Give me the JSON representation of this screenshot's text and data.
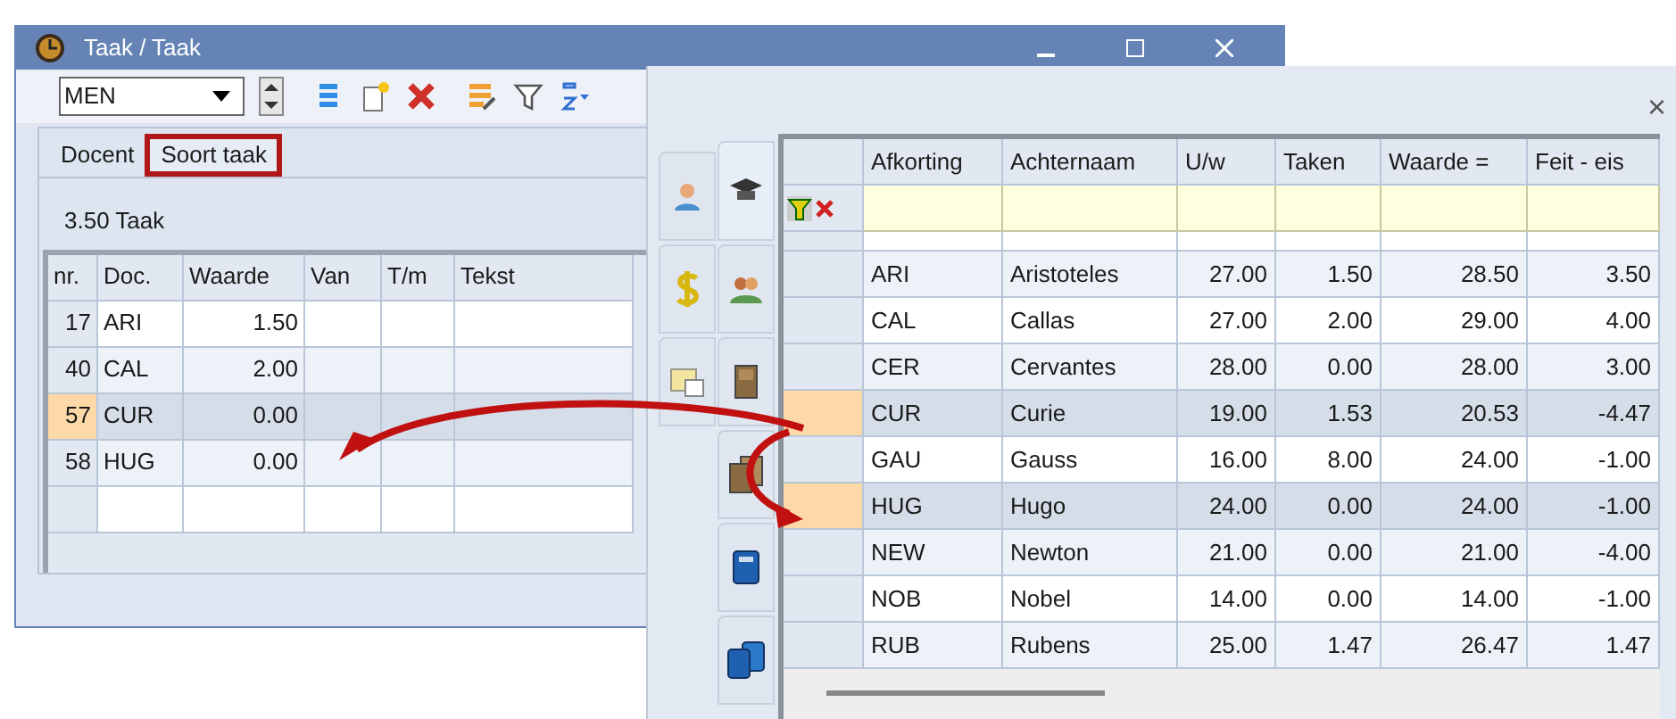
{
  "window": {
    "title": "Taak / Taak"
  },
  "toolbar": {
    "combo_value": "MEN"
  },
  "tabs": [
    {
      "label": "Docent",
      "selected": false
    },
    {
      "label": "Soort taak",
      "selected": true
    }
  ],
  "summary": "3.50 Taak",
  "task_table": {
    "columns": [
      "nr.",
      "Doc.",
      "Waarde",
      "Van",
      "T/m",
      "Tekst"
    ],
    "rows": [
      {
        "cells": [
          "17",
          "ARI",
          "1.50",
          "",
          "",
          ""
        ],
        "selected": false
      },
      {
        "cells": [
          "40",
          "CAL",
          "2.00",
          "",
          "",
          ""
        ],
        "selected": false
      },
      {
        "cells": [
          "57",
          "CUR",
          "0.00",
          "",
          "",
          ""
        ],
        "selected": true
      },
      {
        "cells": [
          "58",
          "HUG",
          "0.00",
          "",
          "",
          ""
        ],
        "selected": false
      }
    ]
  },
  "teacher_table": {
    "columns": [
      "Afkorting",
      "Achternaam",
      "U/w",
      "Taken",
      "Waarde =",
      "Feit - eis"
    ],
    "rows": [
      {
        "cells": [
          "ARI",
          "Aristoteles",
          "27.00",
          "1.50",
          "28.50",
          "3.50"
        ],
        "selected": false
      },
      {
        "cells": [
          "CAL",
          "Callas",
          "27.00",
          "2.00",
          "29.00",
          "4.00"
        ],
        "selected": false
      },
      {
        "cells": [
          "CER",
          "Cervantes",
          "28.00",
          "0.00",
          "28.00",
          "3.00"
        ],
        "selected": false
      },
      {
        "cells": [
          "CUR",
          "Curie",
          "19.00",
          "1.53",
          "20.53",
          "-4.47"
        ],
        "selected": true
      },
      {
        "cells": [
          "GAU",
          "Gauss",
          "16.00",
          "8.00",
          "24.00",
          "-1.00"
        ],
        "selected": false
      },
      {
        "cells": [
          "HUG",
          "Hugo",
          "24.00",
          "0.00",
          "24.00",
          "-1.00"
        ],
        "selected": true
      },
      {
        "cells": [
          "NEW",
          "Newton",
          "21.00",
          "0.00",
          "21.00",
          "-4.00"
        ],
        "selected": false
      },
      {
        "cells": [
          "NOB",
          "Nobel",
          "14.00",
          "0.00",
          "14.00",
          "-1.00"
        ],
        "selected": false
      },
      {
        "cells": [
          "RUB",
          "Rubens",
          "25.00",
          "1.47",
          "26.47",
          "1.47"
        ],
        "selected": false
      }
    ]
  },
  "side_tabs": [
    {
      "selected": false
    },
    {
      "selected": false
    },
    {
      "selected": false
    },
    {
      "selected": true
    },
    {
      "selected": false
    },
    {
      "selected": false
    },
    {
      "selected": false
    },
    {
      "selected": false
    },
    {
      "selected": false
    }
  ],
  "panel_close": "×"
}
